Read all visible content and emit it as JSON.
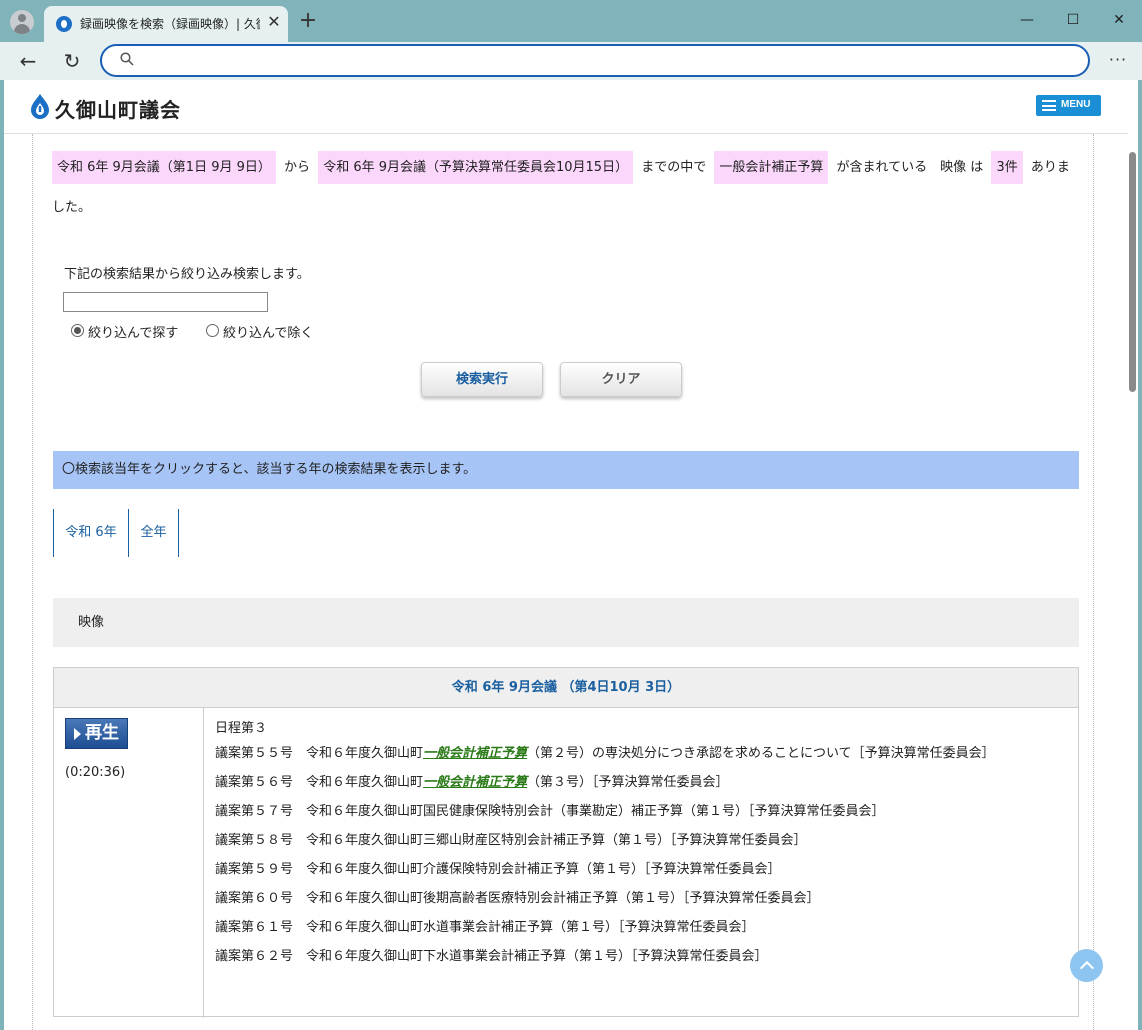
{
  "browser": {
    "tab_title": "録画映像を検索（録画映像）| 久御山町議会",
    "tab_close": "✕",
    "new_tab": "+",
    "minimize": "—",
    "maximize": "☐",
    "close": "✕",
    "back": "←",
    "reload": "↻",
    "more": "···",
    "address_value": "",
    "address_placeholder": ""
  },
  "site": {
    "name": "久御山町議会",
    "menu_label": "MENU"
  },
  "summary": {
    "from": "令和 6年 9月会議（第1日 9月 9日）",
    "from_word": "から",
    "to": "令和 6年 9月会議（予算決算常任委員会10月15日）",
    "to_word": "までの中で",
    "keyword": "一般会計補正予算",
    "contains": "が含まれている　映像 は",
    "count": "3件",
    "found": "ありました。"
  },
  "filter": {
    "label": "下記の検索結果から絞り込み検索します。",
    "input_value": "",
    "radio_include": "絞り込んで探す",
    "radio_exclude": "絞り込んで除く",
    "search_button": "検索実行",
    "clear_button": "クリア"
  },
  "notice": "〇検索該当年をクリックすると、該当する年の検索結果を表示します。",
  "year_tabs": [
    "令和 6年",
    "全年"
  ],
  "section_title": "映像",
  "result": {
    "title": "令和 6年 9月会議 （第4日10月 3日）",
    "play_label": "再生",
    "duration": "(0:20:36)",
    "agenda_head": "日程第３",
    "items": [
      {
        "pre": "議案第５５号　令和６年度久御山町",
        "kw": "一般会計補正予算",
        "post": "（第２号）の専決処分につき承認を求めることについて［予算決算常任委員会］"
      },
      {
        "pre": "議案第５６号　令和６年度久御山町",
        "kw": "一般会計補正予算",
        "post": "（第３号）［予算決算常任委員会］"
      },
      {
        "pre": "議案第５７号　令和６年度久御山町国民健康保険特別会計（事業勘定）補正予算（第１号）［予算決算常任委員会］",
        "kw": "",
        "post": ""
      },
      {
        "pre": "議案第５８号　令和６年度久御山町三郷山財産区特別会計補正予算（第１号）［予算決算常任委員会］",
        "kw": "",
        "post": ""
      },
      {
        "pre": "議案第５９号　令和６年度久御山町介護保険特別会計補正予算（第１号）［予算決算常任委員会］",
        "kw": "",
        "post": ""
      },
      {
        "pre": "議案第６０号　令和６年度久御山町後期高齢者医療特別会計補正予算（第１号）［予算決算常任委員会］",
        "kw": "",
        "post": ""
      },
      {
        "pre": "議案第６１号　令和６年度久御山町水道事業会計補正予算（第１号）［予算決算常任委員会］",
        "kw": "",
        "post": ""
      },
      {
        "pre": "議案第６２号　令和６年度久御山町下水道事業会計補正予算（第１号）［予算決算常任委員会］",
        "kw": "",
        "post": ""
      }
    ]
  }
}
